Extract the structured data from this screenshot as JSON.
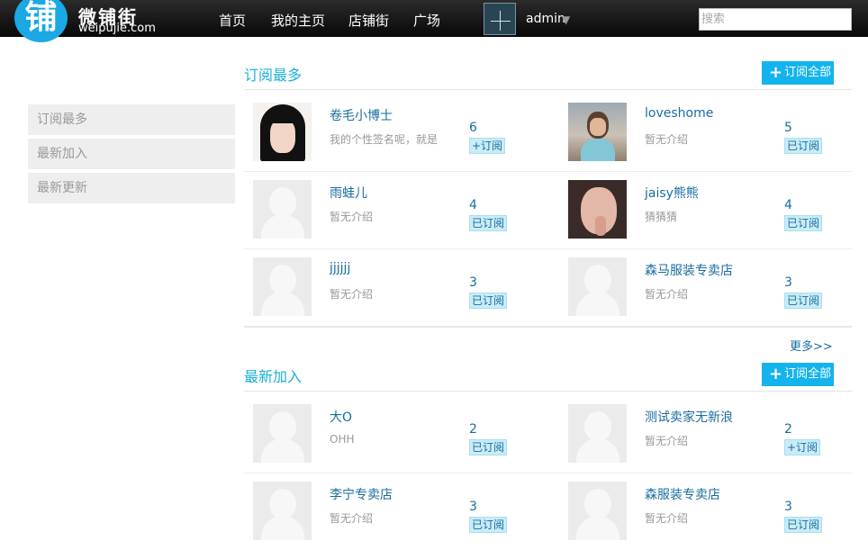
{
  "header": {
    "logo_char": "铺",
    "logo_name": "微铺街",
    "logo_domain": "weipujie.com",
    "nav": [
      "首页",
      "我的主页",
      "店铺街",
      "广场"
    ],
    "username": "admin",
    "search_placeholder": "搜索"
  },
  "sidebar": {
    "items": [
      {
        "label": "订阅最多"
      },
      {
        "label": "最新加入"
      },
      {
        "label": "最新更新"
      }
    ]
  },
  "sections": [
    {
      "title": "订阅最多",
      "action_label": "订阅全部",
      "users": [
        {
          "name": "卷毛小博士",
          "bio": "我的个性签名呢，就是",
          "count": "6",
          "button": "+订阅",
          "photo": "woman-black-hair"
        },
        {
          "name": "loveshome",
          "bio": "暂无介绍",
          "count": "5",
          "button": "已订阅",
          "photo": "woman-glasses-outdoor"
        },
        {
          "name": "雨蛙儿",
          "bio": "暂无介绍",
          "count": "4",
          "button": "已订阅",
          "photo": "default-avatar"
        },
        {
          "name": "jaisy熊熊",
          "bio": "猜猜猜",
          "count": "4",
          "button": "已订阅",
          "photo": "girl-selfie"
        },
        {
          "name": "jjjjjj",
          "bio": "暂无介绍",
          "count": "3",
          "button": "已订阅",
          "photo": "default-avatar"
        },
        {
          "name": "森马服装专卖店",
          "bio": "暂无介绍",
          "count": "3",
          "button": "已订阅",
          "photo": "default-avatar"
        }
      ],
      "more_label": "更多>>"
    },
    {
      "title": "最新加入",
      "action_label": "订阅全部",
      "users": [
        {
          "name": "大O",
          "bio": "OHH",
          "count": "2",
          "button": "已订阅",
          "photo": "default-avatar"
        },
        {
          "name": "测试卖家无新浪",
          "bio": "暂无介绍",
          "count": "2",
          "button": "+订阅",
          "photo": "default-avatar"
        },
        {
          "name": "李宁专卖店",
          "bio": "暂无介绍",
          "count": "3",
          "button": "已订阅",
          "photo": "default-avatar"
        },
        {
          "name": "森服装专卖店",
          "bio": "暂无介绍",
          "count": "3",
          "button": "已订阅",
          "photo": "default-avatar"
        }
      ]
    }
  ],
  "colors": {
    "accent": "#1ab0d6",
    "button_blue": "#13b4ec",
    "link": "#1a6d9e",
    "topbar": "#111111"
  }
}
